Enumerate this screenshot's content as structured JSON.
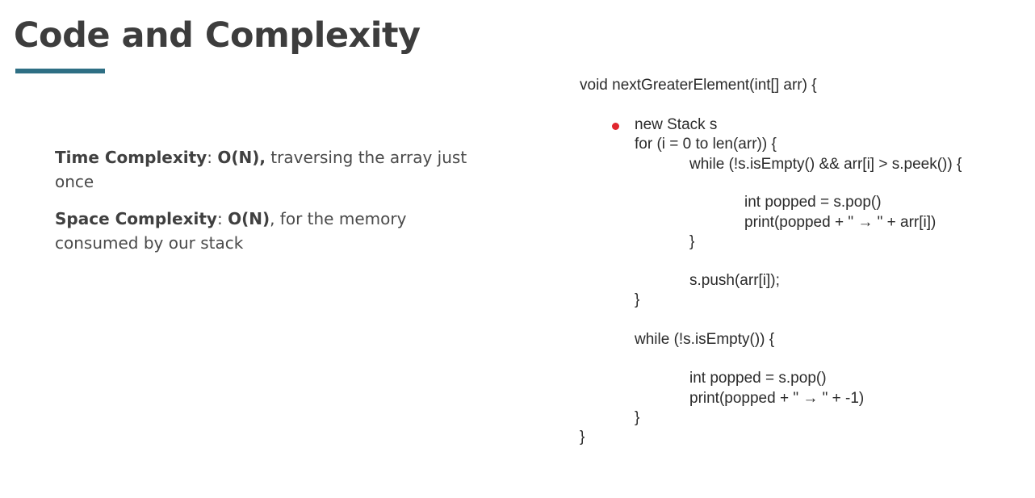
{
  "title": "Code and Complexity",
  "accent_color": "#2e6f84",
  "bullet_color": "#e0262e",
  "time_complexity": {
    "label": "Time Complexity",
    "sep": ": ",
    "value": "O(N),",
    "text": " traversing the array just once"
  },
  "space_complexity": {
    "label": "Space Complexity",
    "sep": ": ",
    "value": "O(N)",
    "text": ", for the memory consumed by our stack"
  },
  "code": {
    "l1": "void nextGreaterElement(int[] arr) {",
    "l2": "new Stack s",
    "l3": "for (i = 0 to len(arr)) {",
    "l4": "while (!s.isEmpty() && arr[i] > s.peek()) {",
    "l5": "int popped = s.pop()",
    "l6": "print(popped + \" → \" + arr[i])",
    "l7": "}",
    "l8": "s.push(arr[i]);",
    "l9": "}",
    "l10": "while (!s.isEmpty()) {",
    "l11": "int popped = s.pop()",
    "l12": "print(popped + \" → \" + -1)",
    "l13": "}",
    "l14": "}"
  }
}
